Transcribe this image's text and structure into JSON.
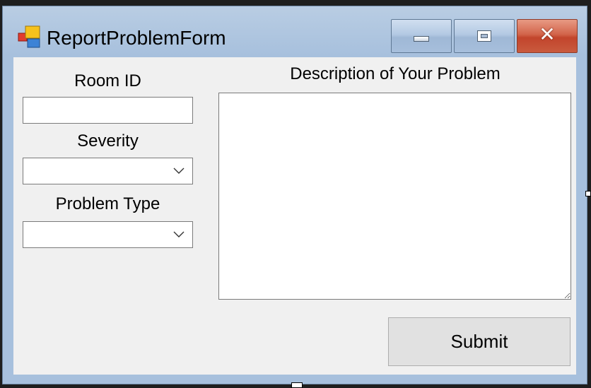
{
  "window": {
    "title": "ReportProblemForm",
    "icon": "windows-form-icon"
  },
  "caption_buttons": {
    "minimize_icon": "minimize-icon",
    "maximize_icon": "maximize-icon",
    "close_icon": "close-icon",
    "close_glyph": "✕"
  },
  "form": {
    "room_id_label": "Room ID",
    "room_id_value": "",
    "severity_label": "Severity",
    "severity_value": "",
    "problem_type_label": "Problem Type",
    "problem_type_value": "",
    "description_label": "Description of Your Problem",
    "description_value": "",
    "submit_label": "Submit"
  },
  "colors": {
    "titlebar": "#a7c0dd",
    "client_bg": "#f0f0f0",
    "close_button": "#c2452c"
  }
}
